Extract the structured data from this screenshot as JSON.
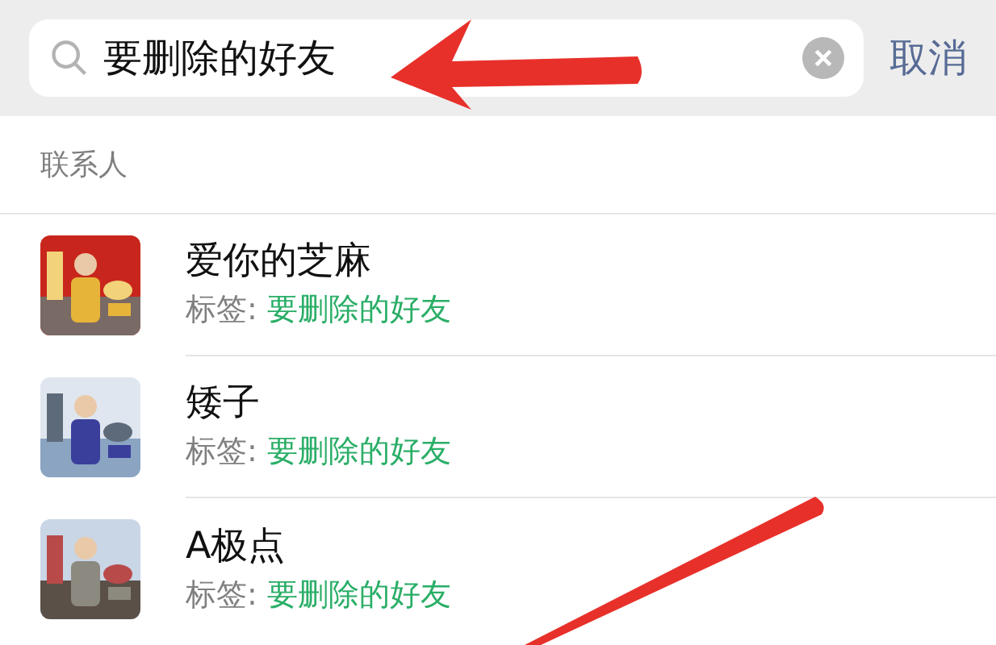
{
  "search": {
    "value": "要删除的好友"
  },
  "cancel": "取消",
  "section_title": "联系人",
  "contacts": [
    {
      "name": "爱你的芝麻",
      "tag_label": "标签:",
      "tag": "要删除的好友"
    },
    {
      "name": "矮子",
      "tag_label": "标签:",
      "tag": "要删除的好友"
    },
    {
      "name": "A极点",
      "tag_label": "标签:",
      "tag": "要删除的好友"
    }
  ]
}
